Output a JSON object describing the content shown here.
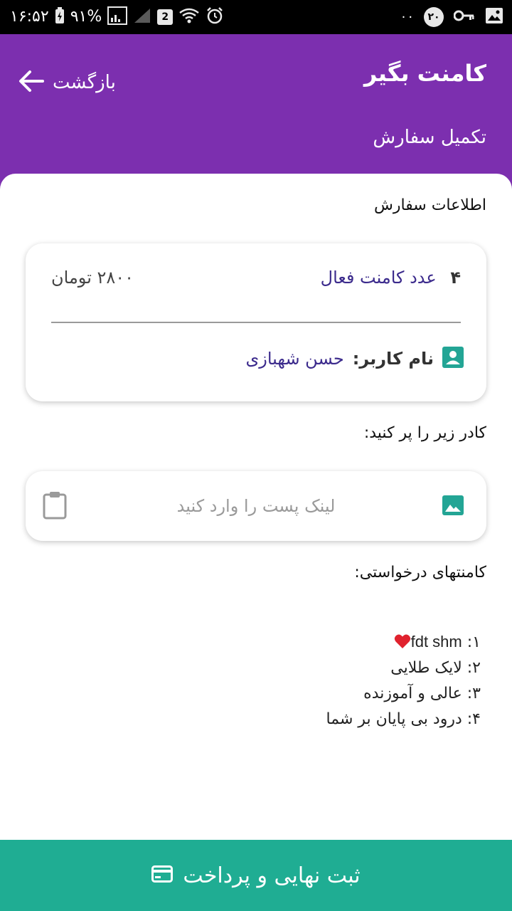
{
  "status_bar": {
    "time": "۱۶:۵۲",
    "battery": "۹۱%",
    "sim_badge": "2",
    "notif_badge": "۲۰",
    "extra": "۰۰"
  },
  "header": {
    "app_title": "کامنت بگیر",
    "back_label": "بازگشت",
    "subtitle": "تکمیل سفارش"
  },
  "order_info": {
    "section_label": "اطلاعات سفارش",
    "quantity": "۴",
    "quantity_label": "عدد کامنت فعال",
    "price": "۲۸۰۰ تومان",
    "username_label": "نام کاربر:",
    "username": "حسن شهبازی"
  },
  "link_input": {
    "section_label": "کادر زیر را پر کنید:",
    "placeholder": "لینک پست را وارد کنید",
    "value": ""
  },
  "comments": {
    "section_label": "کامنتهای درخواستی:",
    "items": [
      {
        "index": "۱:",
        "text": "fdt shm"
      },
      {
        "index": "۲:",
        "text": "لایک طلایی"
      },
      {
        "index": "۳:",
        "text": "عالی و آموزنده"
      },
      {
        "index": "۴:",
        "text": "درود بی پایان  بر شما"
      }
    ]
  },
  "pay_button": {
    "label": "ثبت نهایی و پرداخت"
  },
  "colors": {
    "header": "#7c2faf",
    "accent_text": "#3b2a8c",
    "teal": "#1fad93",
    "icon_teal": "#23a595"
  }
}
